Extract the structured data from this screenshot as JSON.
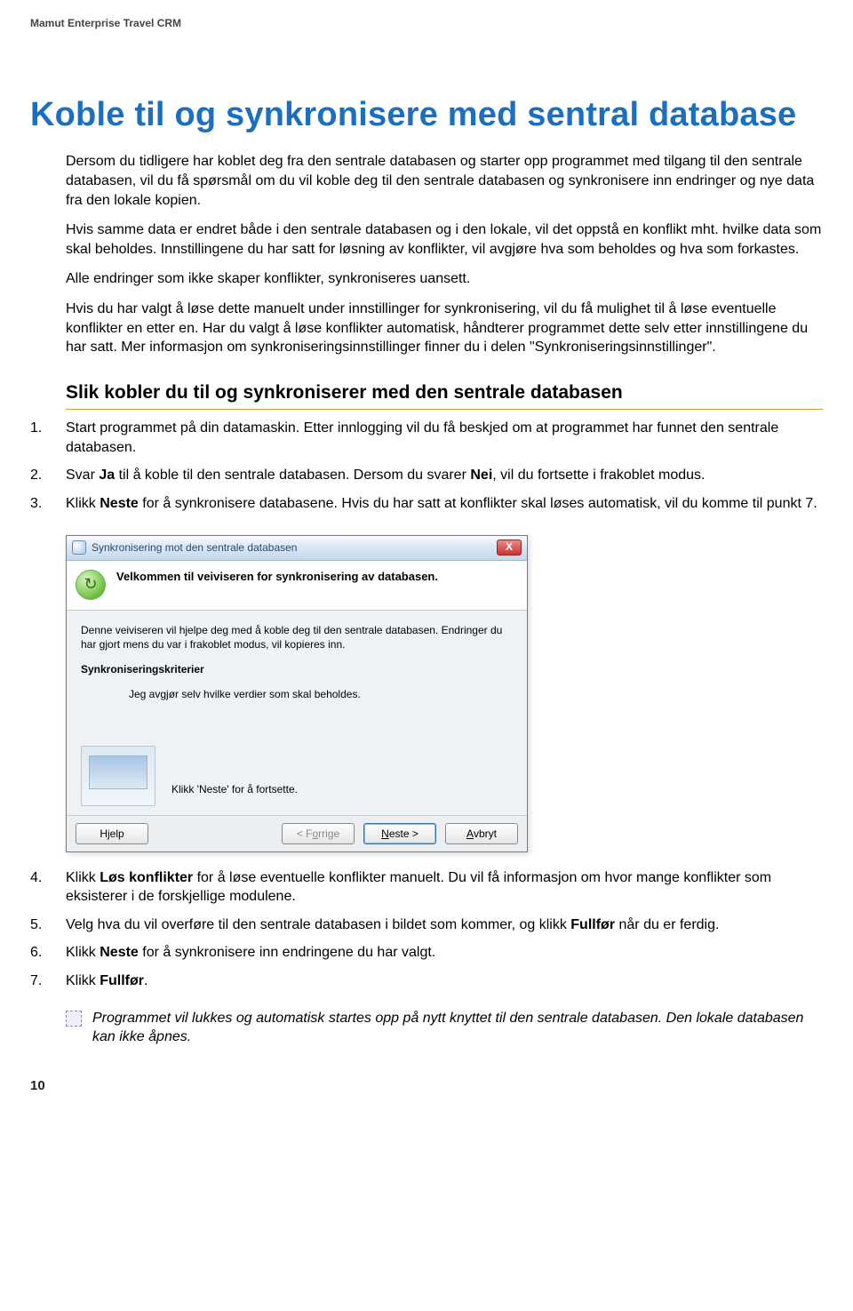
{
  "header": "Mamut Enterprise Travel CRM",
  "title": "Koble til og synkronisere med sentral database",
  "paras": [
    "Dersom du tidligere har koblet deg fra den sentrale databasen og starter opp programmet med tilgang til den sentrale databasen, vil du få spørsmål om du vil koble deg til den sentrale databasen og synkronisere inn endringer og nye data fra den lokale kopien.",
    "Hvis samme data er endret både i den sentrale databasen og i den lokale, vil det oppstå en konflikt mht. hvilke data som skal beholdes. Innstillingene du har satt for løsning av konflikter, vil avgjøre hva som beholdes og hva som forkastes.",
    "Alle endringer som ikke skaper konflikter, synkroniseres uansett.",
    "Hvis du har valgt å løse dette manuelt under innstillinger for synkronisering, vil du få mulighet til å løse eventuelle konflikter en etter en. Har du valgt å løse konflikter automatisk, håndterer programmet dette selv etter innstillingene du har satt. Mer informasjon om synkroniseringsinnstillinger finner du i delen \"Synkroniseringsinnstillinger\"."
  ],
  "subheading": "Slik kobler du til og synkroniserer med den sentrale databasen",
  "steps1": [
    "Start programmet på din datamaskin. Etter innlogging vil du få beskjed om at programmet har funnet den sentrale databasen.",
    "__STEP2__",
    "__STEP3__"
  ],
  "step2_parts": {
    "pre": "Svar ",
    "b1": "Ja",
    "mid": " til å koble til den sentrale databasen. Dersom du svarer ",
    "b2": "Nei",
    "post": ", vil du fortsette i frakoblet modus."
  },
  "step3_parts": {
    "pre": "Klikk ",
    "b1": "Neste",
    "post": " for å synkronisere databasene. Hvis du har satt at konflikter skal løses automatisk, vil du komme til punkt 7."
  },
  "dialog": {
    "title": "Synkronisering mot den sentrale databasen",
    "close": "X",
    "banner_icon": "↻",
    "banner_title": "Velkommen til veiviseren for synkronisering av databasen.",
    "body_intro": "Denne veiviseren vil hjelpe deg med å koble deg til den sentrale databasen. Endringer du har gjort mens du var i frakoblet modus, vil kopieres inn.",
    "criteria_label": "Synkroniseringskriterier",
    "criteria_value": "Jeg avgjør selv hvilke verdier som skal beholdes.",
    "continue_hint": "Klikk 'Neste' for å fortsette.",
    "buttons": {
      "help_pre": "H",
      "help_u": "j",
      "help_post": "elp",
      "back_pre": "< F",
      "back_u": "o",
      "back_post": "rrige",
      "next_u": "N",
      "next_post": "este >",
      "cancel_u": "A",
      "cancel_post": "vbryt"
    }
  },
  "steps2": [
    "__STEP4__",
    "__STEP5__",
    "__STEP6__",
    "__STEP7__"
  ],
  "step4_parts": {
    "pre": "Klikk ",
    "b1": "Løs konflikter",
    "post": " for å løse eventuelle konflikter manuelt. Du vil få informasjon om hvor mange konflikter som eksisterer i de forskjellige modulene."
  },
  "step5_parts": {
    "pre": "Velg hva du vil overføre til den sentrale databasen i bildet som kommer, og klikk ",
    "b1": "Fullfør",
    "post": " når du er ferdig."
  },
  "step6_parts": {
    "pre": "Klikk ",
    "b1": "Neste",
    "post": " for å synkronisere inn endringene du har valgt."
  },
  "step7_parts": {
    "pre": "Klikk ",
    "b1": "Fullfør",
    "post": "."
  },
  "tip": "Programmet vil lukkes og automatisk startes opp på nytt knyttet til den sentrale databasen. Den lokale databasen kan ikke åpnes.",
  "page_number": "10"
}
